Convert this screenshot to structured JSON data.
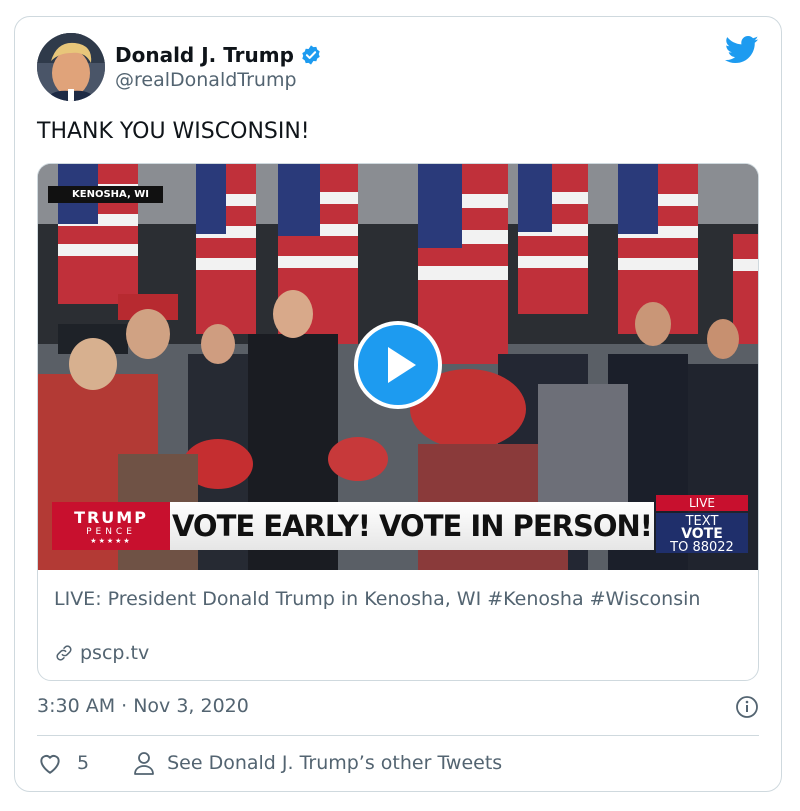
{
  "author": {
    "name": "Donald J. Trump",
    "handle": "@realDonaldTrump"
  },
  "tweet": {
    "text": "THANK YOU WISCONSIN!",
    "timestamp": "3:30 AM · Nov 3, 2020"
  },
  "media": {
    "location_tag": "KENOSHA, WI",
    "banner_logo_top": "TRUMP",
    "banner_logo_bottom": "PENCE",
    "banner_logo_stars": "★★★★★",
    "banner_text": "VOTE EARLY! VOTE IN PERSON!",
    "live_label": "LIVE",
    "text_line1": "TEXT",
    "text_line2": "VOTE",
    "text_line3": "TO 88022"
  },
  "link_card": {
    "title": "LIVE: President Donald Trump in Kenosha, WI #Kenosha #Wisconsin",
    "domain": "pscp.tv"
  },
  "actions": {
    "like_count": "5",
    "see_other": "See Donald J. Trump’s other Tweets"
  },
  "colors": {
    "twitter_blue": "#1d9bf0",
    "banner_red": "#c8102e",
    "banner_navy": "#1f2f6b"
  },
  "icons": [
    "verified-badge-icon",
    "twitter-bird-icon",
    "play-icon",
    "link-icon",
    "info-icon",
    "heart-icon",
    "person-icon"
  ]
}
